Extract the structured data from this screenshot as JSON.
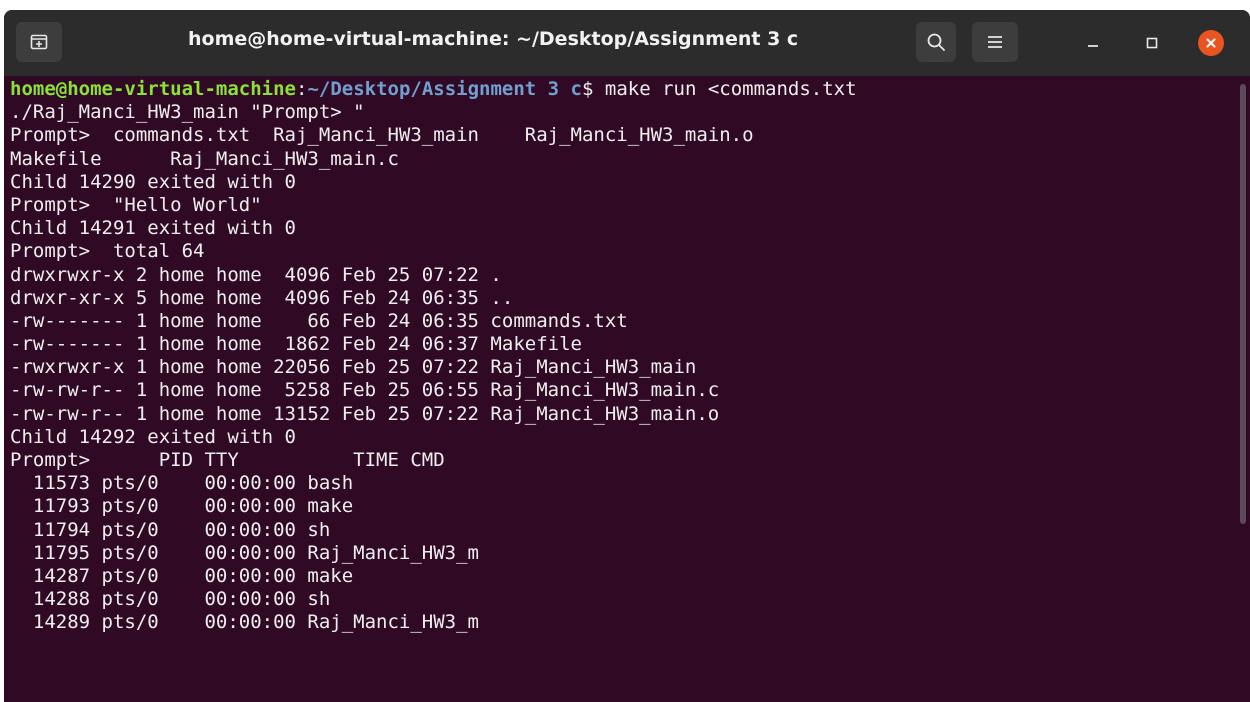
{
  "window": {
    "title": "home@home-virtual-machine: ~/Desktop/Assignment 3 c",
    "colors": {
      "titlebar": "#2c2c2c",
      "terminal_bg": "#300a24",
      "close_button": "#e95420",
      "prompt_user": "#8ae234",
      "prompt_path": "#729fcf",
      "text": "#eeeeee"
    }
  },
  "icons": {
    "new_tab": "new-tab-icon",
    "search": "search-icon",
    "menu": "hamburger-menu-icon",
    "minimize": "minimize-icon",
    "maximize": "maximize-icon",
    "close": "close-icon"
  },
  "terminal": {
    "prompt": {
      "user_host": "home@home-virtual-machine",
      "separator": ":",
      "path": "~/Desktop/Assignment 3 c",
      "symbol": "$",
      "command": " make run <commands.txt"
    },
    "lines": [
      "./Raj_Manci_HW3_main \"Prompt> \"",
      "Prompt>  commands.txt  Raj_Manci_HW3_main    Raj_Manci_HW3_main.o",
      "Makefile      Raj_Manci_HW3_main.c",
      "Child 14290 exited with 0",
      "Prompt>  \"Hello World\"",
      "Child 14291 exited with 0",
      "Prompt>  total 64",
      "drwxrwxr-x 2 home home  4096 Feb 25 07:22 .",
      "drwxr-xr-x 5 home home  4096 Feb 24 06:35 ..",
      "-rw------- 1 home home    66 Feb 24 06:35 commands.txt",
      "-rw------- 1 home home  1862 Feb 24 06:37 Makefile",
      "-rwxrwxr-x 1 home home 22056 Feb 25 07:22 Raj_Manci_HW3_main",
      "-rw-rw-r-- 1 home home  5258 Feb 25 06:55 Raj_Manci_HW3_main.c",
      "-rw-rw-r-- 1 home home 13152 Feb 25 07:22 Raj_Manci_HW3_main.o",
      "Child 14292 exited with 0",
      "Prompt>      PID TTY          TIME CMD",
      "  11573 pts/0    00:00:00 bash",
      "  11793 pts/0    00:00:00 make",
      "  11794 pts/0    00:00:00 sh",
      "  11795 pts/0    00:00:00 Raj_Manci_HW3_m",
      "  14287 pts/0    00:00:00 make",
      "  14288 pts/0    00:00:00 sh",
      "  14289 pts/0    00:00:00 Raj_Manci_HW3_m"
    ]
  }
}
